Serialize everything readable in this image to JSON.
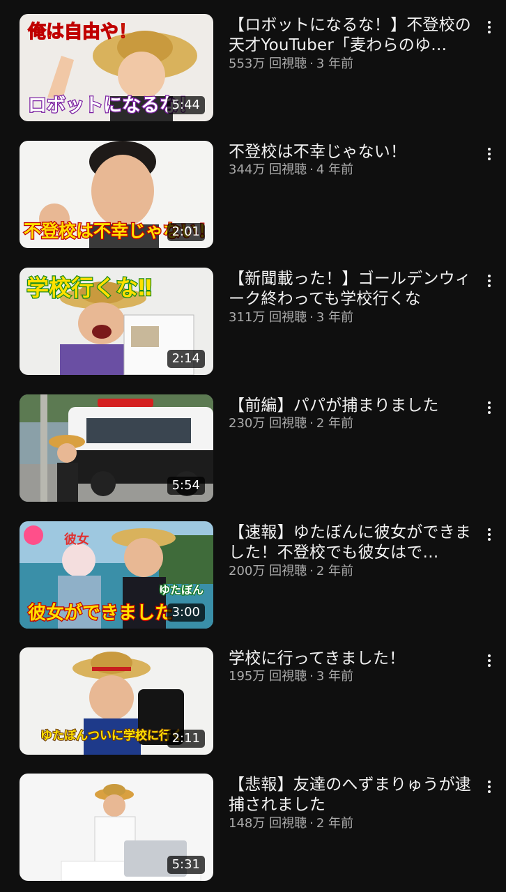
{
  "videos": [
    {
      "title": "【ロボットになるな！】不登校の天才YouTuber「麦わらのゆ…",
      "views": "553万 回視聴",
      "age": "3 年前",
      "duration": "5:44",
      "thumb_caption_top": "俺は自由や！",
      "thumb_caption_bottom": "ロボットになるな！"
    },
    {
      "title": "不登校は不幸じゃない！",
      "views": "344万 回視聴",
      "age": "4 年前",
      "duration": "2:01",
      "thumb_caption_bottom": "不登校は不幸じゃない！"
    },
    {
      "title": "【新聞載った！】ゴールデンウィーク終わっても学校行くな",
      "views": "311万 回視聴",
      "age": "3 年前",
      "duration": "2:14",
      "thumb_caption_top": "学校行くな‼"
    },
    {
      "title": "【前編】パパが捕まりました",
      "views": "230万 回視聴",
      "age": "2 年前",
      "duration": "5:54"
    },
    {
      "title": "【速報】ゆたぼんに彼女ができました！不登校でも彼女はで…",
      "views": "200万 回視聴",
      "age": "2 年前",
      "duration": "3:00",
      "thumb_caption_top": "彼女",
      "thumb_caption_bottom": "彼女ができました",
      "thumb_badge": "ゆたぼん"
    },
    {
      "title": "学校に行ってきました！",
      "views": "195万 回視聴",
      "age": "3 年前",
      "duration": "2:11",
      "thumb_caption_bottom": "ゆたぼんついに学校に行く"
    },
    {
      "title": "【悲報】友達のへずまりゅうが逮捕されました",
      "views": "148万 回視聴",
      "age": "2 年前",
      "duration": "5:31"
    }
  ],
  "ui": {
    "meta_separator": "·",
    "more_icon": "more-vert-icon"
  }
}
